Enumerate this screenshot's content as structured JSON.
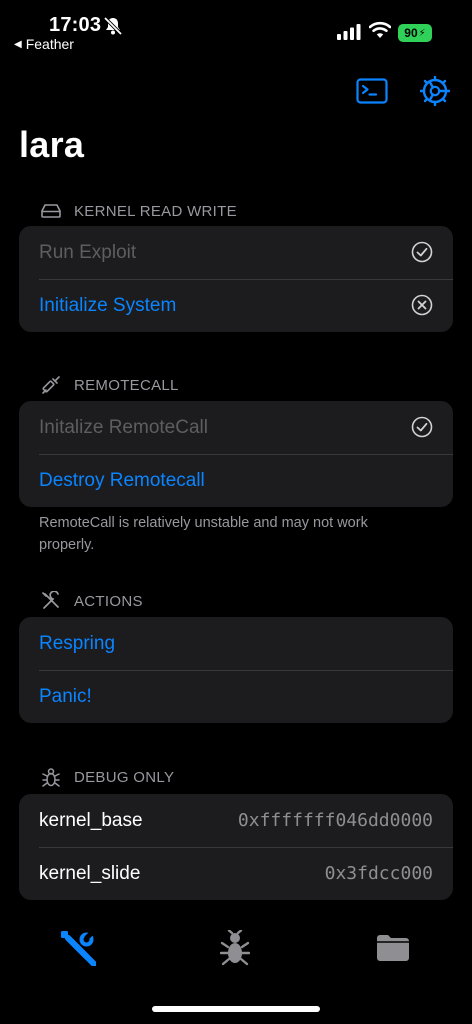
{
  "status_bar": {
    "time": "17:03",
    "back_app": "Feather",
    "battery": "90",
    "icons": [
      "bell-slash-icon",
      "signal-icon",
      "wifi-icon",
      "bolt-icon"
    ]
  },
  "nav": {
    "icons": [
      "terminal-icon",
      "gear-icon"
    ],
    "accent": "#0a84ff"
  },
  "page": {
    "title": "lara"
  },
  "sections": {
    "kernel": {
      "header": "KERNEL READ WRITE",
      "icon": "drive-icon",
      "rows": [
        {
          "label": "Run Exploit",
          "state": "disabled",
          "status_icon": "checkmark-circle-icon"
        },
        {
          "label": "Initialize System",
          "state": "link",
          "status_icon": "xmark-circle-icon"
        }
      ]
    },
    "remotecall": {
      "header": "REMOTECALL",
      "icon": "syringe-icon",
      "rows": [
        {
          "label": "Initalize RemoteCall",
          "state": "disabled",
          "status_icon": "checkmark-circle-icon"
        },
        {
          "label": "Destroy Remotecall",
          "state": "link"
        }
      ],
      "footer": "RemoteCall is relatively unstable and may not work properly."
    },
    "actions": {
      "header": "ACTIONS",
      "icon": "tools-icon",
      "rows": [
        {
          "label": "Respring",
          "state": "link"
        },
        {
          "label": "Panic!",
          "state": "link"
        }
      ]
    },
    "debug": {
      "header": "DEBUG ONLY",
      "icon": "ant-icon",
      "rows": [
        {
          "label": "kernel_base",
          "value": "0xfffffff046dd0000"
        },
        {
          "label": "kernel_slide",
          "value": "0x3fdcc000"
        }
      ]
    }
  },
  "tab_bar": {
    "tabs": [
      {
        "icon": "wrench-screwdriver-icon",
        "selected": true
      },
      {
        "icon": "ant-icon",
        "selected": false
      },
      {
        "icon": "folder-icon",
        "selected": false
      }
    ]
  },
  "colors": {
    "background": "#000000",
    "card": "#1c1c1e",
    "accent": "#0a84ff",
    "secondary_text": "#98989f",
    "disabled_text": "#5d5d62",
    "battery": "#30d158"
  }
}
